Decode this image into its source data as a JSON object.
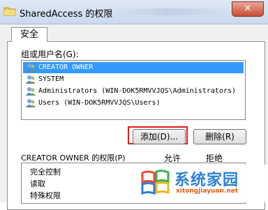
{
  "window": {
    "title": "SharedAccess 的权限",
    "close_glyph": "✕"
  },
  "tabs": [
    {
      "label": "安全"
    }
  ],
  "groups": {
    "label": "组或用户名(G):",
    "items": [
      {
        "label": "CREATOR OWNER",
        "icon": "user-group-icon",
        "selected": true
      },
      {
        "label": "SYSTEM",
        "icon": "user-group-icon",
        "selected": false
      },
      {
        "label": "Administrators (WIN-DOK5RMVVJQS\\Administrators)",
        "icon": "user-group-icon",
        "selected": false
      },
      {
        "label": "Users (WIN-DOK5RMVVJQS\\Users)",
        "icon": "user-group-icon",
        "selected": false
      }
    ]
  },
  "buttons": {
    "add": "添加(D)...",
    "remove": "删除(R)"
  },
  "permissions": {
    "label": "CREATOR OWNER 的权限(P)",
    "allow_header": "允许",
    "deny_header": "拒绝",
    "items": [
      "完全控制",
      "读取",
      "特殊权限"
    ]
  },
  "watermark": {
    "brand": "系统家园",
    "url": "xitongjiayuan.net"
  },
  "colors": {
    "selection": "#3399ff",
    "highlight_box": "#e01b1b",
    "brand_blue": "#2b7fd6",
    "url_orange": "#e8590c"
  }
}
